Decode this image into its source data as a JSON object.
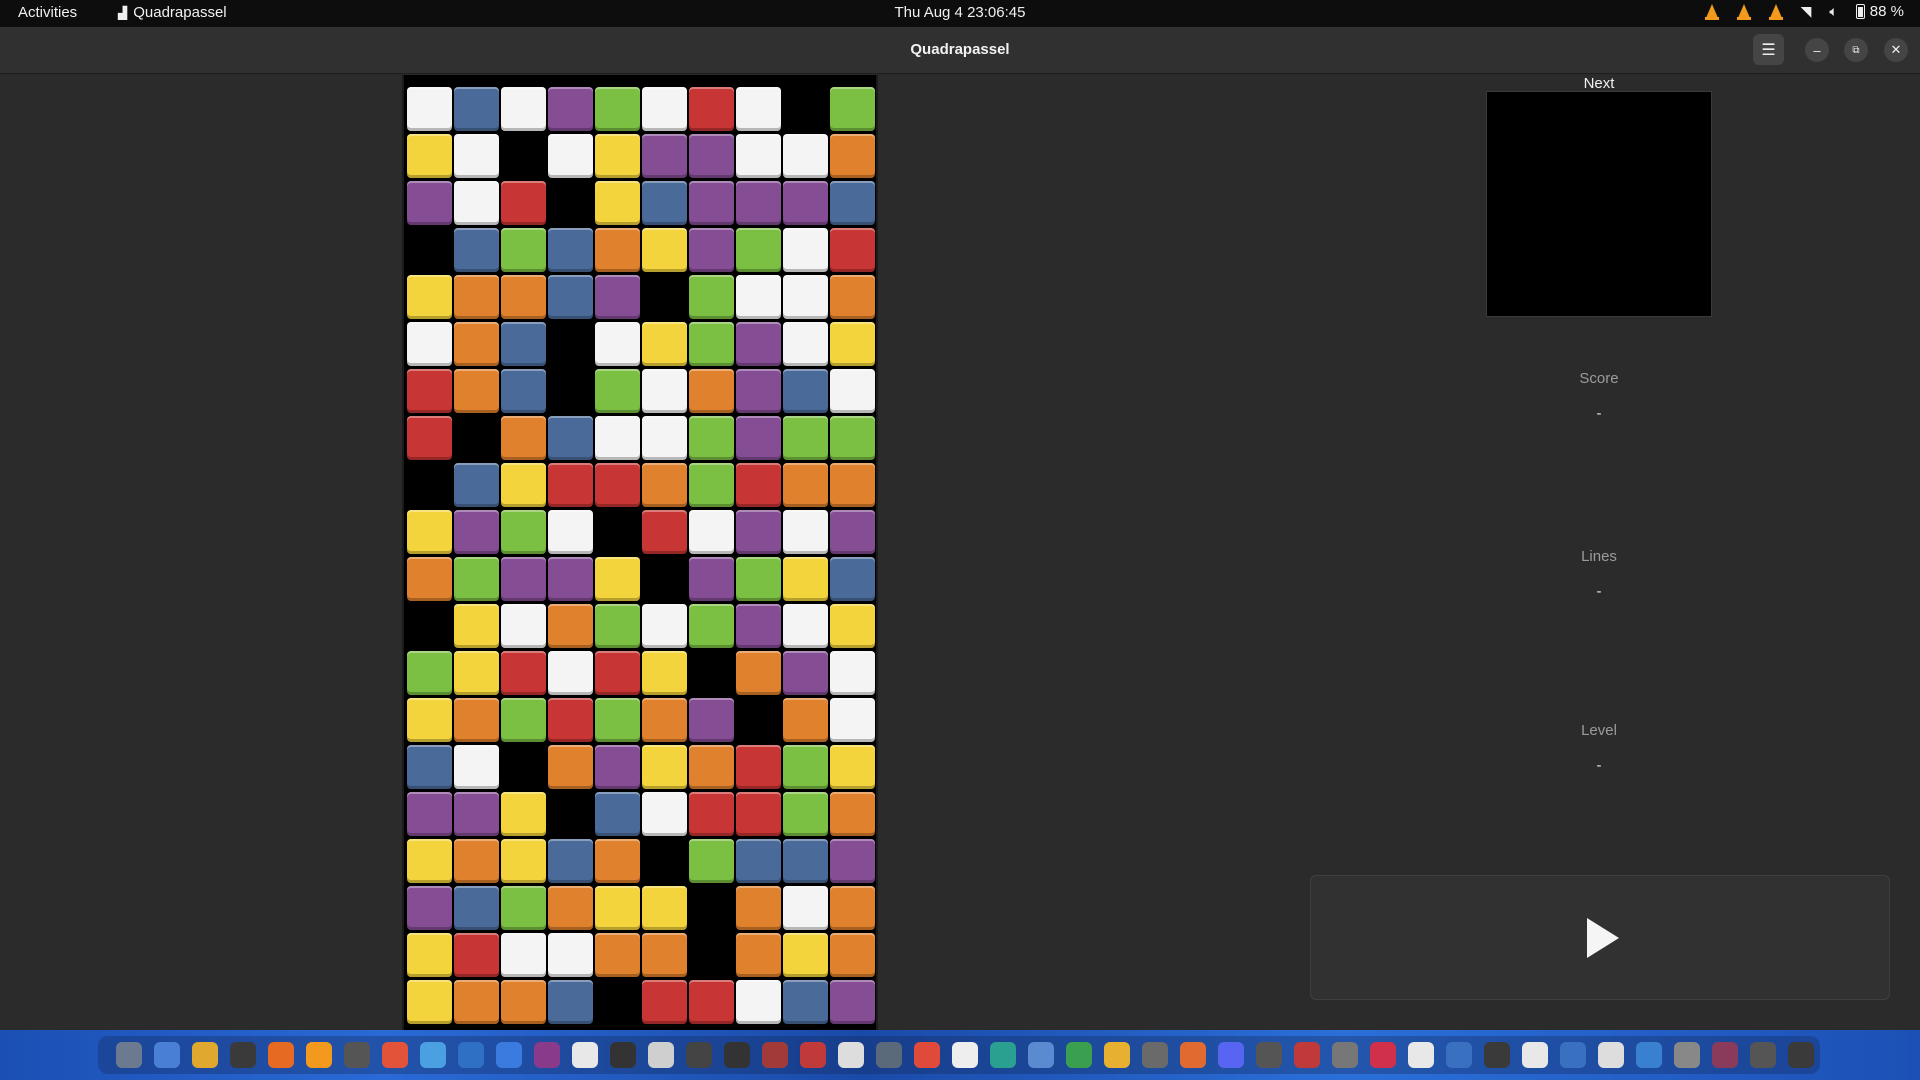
{
  "topbar": {
    "activities": "Activities",
    "app_name": "Quadrapassel",
    "clock": "Thu Aug 4  23:06:45",
    "battery": "88 %",
    "tray_icons": [
      "vlc-cone-icon",
      "vlc-cone-icon",
      "vlc-cone-icon",
      "wifi-icon",
      "volume-icon",
      "battery-icon"
    ]
  },
  "window": {
    "title": "Quadrapassel",
    "menu_icon": "hamburger-menu-icon",
    "minimize_icon": "minimize-icon",
    "restore_icon": "restore-icon",
    "close_icon": "close-icon"
  },
  "sidebar": {
    "next_label": "Next",
    "score_label": "Score",
    "score_value": "-",
    "lines_label": "Lines",
    "lines_value": "-",
    "level_label": "Level",
    "level_value": "-",
    "play_icon": "play-icon"
  },
  "board": {
    "cols": 10,
    "legend": {
      "W": "#f4f4f4",
      "B": "#4a6b9a",
      "P": "#844d94",
      "G": "#7bbf43",
      "R": "#c73634",
      "Y": "#f3d43d",
      "O": "#e0812d",
      "K": "#000000"
    },
    "rows": [
      "WBWPGWRWKG",
      "YWKWYPPWWO",
      "PWRKYBPPPB",
      "KBGBOYPGWR",
      "YOOBPKGWWO",
      "WOBKWYGPWY",
      "ROBKGWOPBW",
      "RKOBWWGPGG",
      "KBYRROGROO",
      "YPGWKRWPWP",
      "OGPPYKPGYB",
      "KYWOGWGPWY",
      "GYRWRYKOPW",
      "YOGRGOPKOW",
      "BWKOPYORGY",
      "PPYKBWRRGO",
      "YOYBOKGBBP",
      "PBGOYYKOWO",
      "YRWWOOKOYO",
      "YOOBKRRWBP"
    ]
  },
  "dock": {
    "icons": [
      "files-icon",
      "text-editor-icon",
      "archive-icon",
      "terminal-icon",
      "firefox-icon",
      "vlc-icon",
      "settings-circle-icon",
      "software-store-icon",
      "notes-icon",
      "calculator-icon",
      "help-icon",
      "image-viewer-icon",
      "document-icon",
      "game-icon",
      "package-icon",
      "media-icon",
      "chevron-up-icon",
      "ship-icon",
      "chess-icon",
      "clipboard-icon",
      "search-app-icon",
      "chrome-icon",
      "reader-icon",
      "monitor-icon",
      "camera-icon",
      "spreadsheet-icon",
      "folder-icon",
      "archive2-icon",
      "presentation-icon",
      "discord-icon",
      "disc-icon",
      "pdf-icon",
      "calc-tool-icon",
      "screen-record-icon",
      "tools-icon",
      "writer-icon",
      "accessibility-icon",
      "cards-icon",
      "drive-icon",
      "doc-viewer-icon",
      "windows-icon",
      "camera2-icon",
      "quadrapassel-icon",
      "trash-icon",
      "app-grid-icon"
    ],
    "colors": [
      "#6b7a8f",
      "#4a7fd6",
      "#e0a82e",
      "#3a3a3a",
      "#e66a22",
      "#f39a1e",
      "#555555",
      "#e2533a",
      "#4aa0e0",
      "#2f6fc4",
      "#3a7be0",
      "#8a3a8a",
      "#e8e8e8",
      "#333333",
      "#cfcfcf",
      "#444444",
      "#333333",
      "#a33a3a",
      "#c03a3a",
      "#dddddd",
      "#5a6a7a",
      "#e04a3a",
      "#eeeeee",
      "#2aa090",
      "#5a8ad0",
      "#3aa050",
      "#e8b030",
      "#6a6a6a",
      "#e06a30",
      "#5865f2",
      "#555555",
      "#c03a3a",
      "#777777",
      "#d0304a",
      "#e8e8e8",
      "#3a70c0",
      "#3a3a3a",
      "#e8e8e8",
      "#3a70c0",
      "#dddddd",
      "#3a80d0",
      "#888888",
      "#8a3a5a",
      "#555555",
      "#3a3a3a"
    ]
  }
}
